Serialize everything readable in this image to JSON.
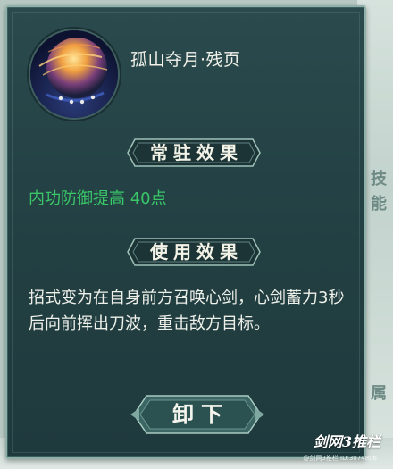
{
  "item": {
    "title": "孤山夺月·残页",
    "icon": "moon-sword-icon"
  },
  "sections": {
    "constant": {
      "header": "常驻效果",
      "effect": "内功防御提高 40点"
    },
    "usage": {
      "header": "使用效果",
      "description": "招式变为在自身前方召唤心剑，心剑蓄力3秒后向前挥出刀波，重击敌方目标。"
    }
  },
  "actions": {
    "unload_label": "卸下"
  },
  "background": {
    "side_tabs": [
      "技",
      "能",
      "属"
    ]
  },
  "watermark": {
    "logo": "剑网3推栏",
    "sub": "@剑网3推栏 ID:3074806"
  },
  "colors": {
    "panel": "#223f42",
    "effect_green": "#39c768",
    "border": "#8fb1aa"
  }
}
